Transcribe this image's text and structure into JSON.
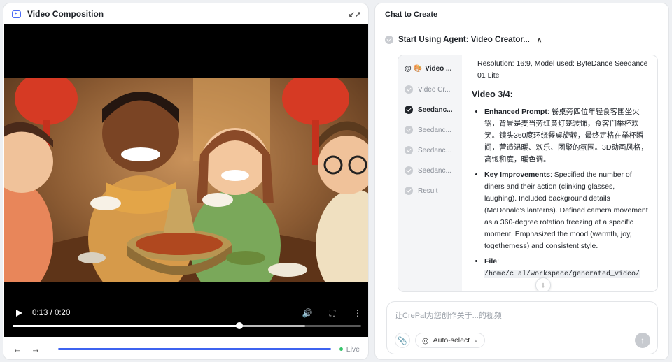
{
  "video_panel": {
    "title": "Video Composition",
    "time": "0:13 / 0:20",
    "progress": 0.65,
    "buffered": 0.84,
    "live_label": "Live"
  },
  "chat_panel": {
    "title": "Chat to Create",
    "agent_title": "Start Using Agent: Video Creator...",
    "steps": [
      {
        "label": "Video ...",
        "state": "current"
      },
      {
        "label": "Video Cr...",
        "state": "done"
      },
      {
        "label": "Seedanc...",
        "state": "active"
      },
      {
        "label": "Seedanc...",
        "state": "done"
      },
      {
        "label": "Seedanc...",
        "state": "done"
      },
      {
        "label": "Seedanc...",
        "state": "done"
      },
      {
        "label": "Result",
        "state": "done"
      }
    ],
    "content": {
      "intro": "Resolution: 16:9, Model used: ByteDance Seedance 01 Lite",
      "heading": "Video 3/4:",
      "enhanced_label": "Enhanced Prompt",
      "enhanced_text": ": 餐桌旁四位年轻食客围坐火锅，背景是麦当劳红黄灯笼装饰，食客们举杯欢笑。镜头360度环绕餐桌旋转，最终定格在举杯瞬间，营造温暖、欢乐、团聚的氛围。3D动画风格，高饱和度，暖色调。",
      "improve_label": "Key Improvements",
      "improve_text": ": Specified the number of diners and their action (clinking glasses, laughing). Included background details (McDonald's lanterns). Defined camera movement as a 360-degree rotation freezing at a specific moment. Emphasized the mood (warmth, joy, togetherness) and consistent style.",
      "file_label": "File",
      "file_path": "/home/c   al/workspace/generated_video/"
    },
    "input_placeholder": "让CrePal为您创作关于...的视频",
    "model_label": "Auto-select"
  },
  "colors": {
    "accent": "#3e63f0",
    "live": "#35c46a"
  }
}
